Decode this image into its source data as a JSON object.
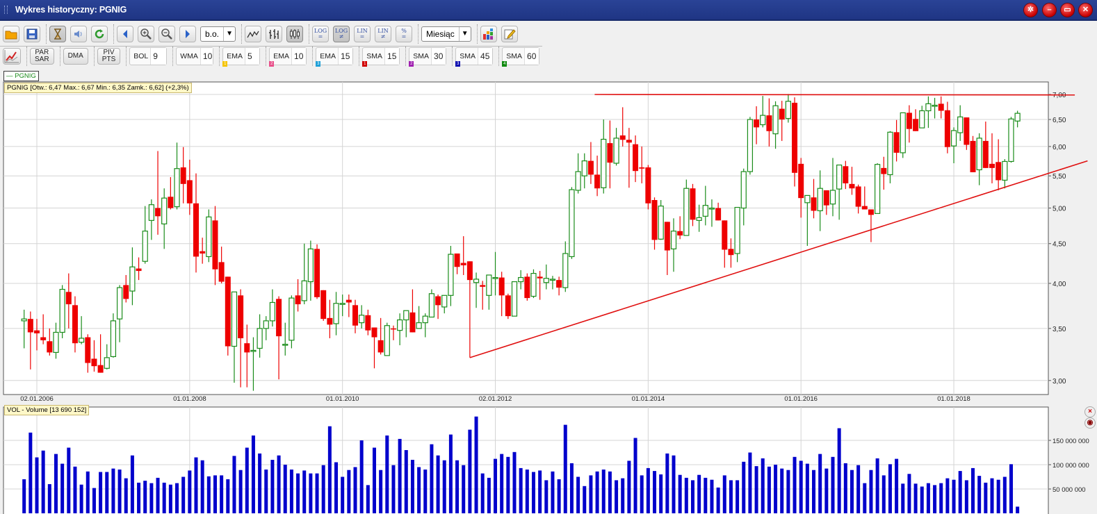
{
  "window": {
    "title": "Wykres historyczny: PGNIG",
    "controls": [
      "settings-icon",
      "minimize-icon",
      "print-icon",
      "close-icon"
    ]
  },
  "toolbar1": [
    [
      {
        "icon": "folder-icon"
      },
      {
        "icon": "save-icon"
      }
    ],
    [
      {
        "icon": "hourglass-icon",
        "pressed": true
      },
      {
        "icon": "speaker-icon"
      },
      {
        "icon": "refresh-icon"
      }
    ],
    [
      {
        "icon": "arrow-left-icon"
      },
      {
        "icon": "zoom-in-icon"
      },
      {
        "icon": "zoom-out-icon"
      },
      {
        "icon": "arrow-right-icon"
      },
      {
        "select": "b.o."
      }
    ],
    [
      {
        "icon": "line-chart-icon"
      },
      {
        "icon": "bar-chart-icon"
      },
      {
        "icon": "candlestick-chart-icon",
        "pressed": true
      }
    ],
    [
      {
        "label": "LOG\n=",
        "name": "log-equal"
      },
      {
        "label": "LOG\n≠",
        "name": "log-notequal",
        "pressed": true
      },
      {
        "label": "LIN\n=",
        "name": "lin-equal"
      },
      {
        "label": "LIN\n≠",
        "name": "lin-notequal"
      },
      {
        "label": "%\n=",
        "name": "percent-equal"
      }
    ],
    [
      {
        "select": "Miesiąc"
      }
    ],
    [
      {
        "icon": "palette-icon"
      },
      {
        "icon": "edit-icon"
      }
    ]
  ],
  "toolbar2": {
    "indicators_icon": "indicators-chart-icon",
    "buttons": [
      "PAR\nSAR",
      "DMA",
      "PIV\nPTS"
    ],
    "params": [
      {
        "name": "BOL",
        "value": "9"
      },
      {
        "name": "WMA",
        "value": "10"
      },
      {
        "name": "EMA",
        "value": "5",
        "badge": "1",
        "color": "#f5c400"
      },
      {
        "name": "EMA",
        "value": "10",
        "badge": "2",
        "color": "#e8508a"
      },
      {
        "name": "EMA",
        "value": "15",
        "badge": "3",
        "color": "#1ea0d8"
      },
      {
        "name": "SMA",
        "value": "15",
        "badge": "1",
        "color": "#d00000"
      },
      {
        "name": "SMA",
        "value": "30",
        "badge": "2",
        "color": "#a020b0"
      },
      {
        "name": "SMA",
        "value": "45",
        "badge": "3",
        "color": "#1010b0"
      },
      {
        "name": "SMA",
        "value": "60",
        "badge": "4",
        "color": "#108a10"
      }
    ]
  },
  "legend": {
    "label": "— PGNIG"
  },
  "info": {
    "text": "PGNIG [Otw.: 6,47  Max.: 6,67  Min.: 6,35  Zamk.: 6,62] (+2,3%)"
  },
  "volume_info": {
    "text": "VOL - Volume [13 690 152]"
  },
  "colors": {
    "up": "#1a8c1a",
    "down": "#ee0000",
    "volume": "#0000cc",
    "trendline": "#e01010",
    "grid": "#d4d4d4"
  },
  "chart_data": [
    {
      "type": "candlestick",
      "title": "PGNIG",
      "scale": "log",
      "interval": "month",
      "first_period": "2005-11",
      "ylim": [
        2.9,
        7.05
      ],
      "yticks": [
        7.0,
        6.5,
        6.0,
        5.5,
        5.0,
        4.5,
        4.0,
        3.5,
        3.0
      ],
      "ytick_labels": [
        "7,00",
        "6,50",
        "6,00",
        "5,50",
        "5,00",
        "4,50",
        "4,00",
        "3,50",
        "3,00"
      ],
      "xticks": [
        {
          "index": 3,
          "label": "02.01.2006"
        },
        {
          "index": 27,
          "label": "01.01.2008"
        },
        {
          "index": 51,
          "label": "01.01.2010"
        },
        {
          "index": 75,
          "label": "02.01.2012"
        },
        {
          "index": 99,
          "label": "01.01.2014"
        },
        {
          "index": 123,
          "label": "01.01.2016"
        },
        {
          "index": 147,
          "label": "01.01.2018"
        }
      ],
      "ohlc": [
        [
          3.58,
          3.7,
          3.3,
          3.6
        ],
        [
          3.6,
          3.68,
          3.1,
          3.46
        ],
        [
          3.48,
          3.6,
          3.28,
          3.45
        ],
        [
          3.41,
          3.65,
          3.34,
          3.38
        ],
        [
          3.37,
          3.5,
          3.23,
          3.26
        ],
        [
          3.26,
          3.56,
          3.2,
          3.46
        ],
        [
          3.46,
          3.98,
          3.4,
          3.93
        ],
        [
          3.9,
          4.12,
          3.5,
          3.76
        ],
        [
          3.75,
          3.85,
          3.26,
          3.35
        ],
        [
          3.36,
          3.63,
          3.34,
          3.4
        ],
        [
          3.41,
          3.44,
          3.07,
          3.16
        ],
        [
          3.2,
          3.38,
          3.08,
          3.13
        ],
        [
          3.14,
          3.44,
          3.07,
          3.07
        ],
        [
          3.11,
          3.34,
          3.1,
          3.21
        ],
        [
          3.22,
          3.66,
          3.21,
          3.58
        ],
        [
          3.6,
          3.98,
          3.36,
          3.95
        ],
        [
          3.98,
          4.1,
          3.78,
          3.82
        ],
        [
          3.91,
          4.45,
          3.75,
          4.2
        ],
        [
          4.18,
          4.32,
          4.04,
          4.15
        ],
        [
          4.27,
          5.03,
          4.24,
          4.67
        ],
        [
          4.82,
          5.13,
          4.55,
          5.05
        ],
        [
          5.0,
          5.92,
          4.62,
          4.88
        ],
        [
          4.77,
          5.3,
          4.43,
          5.15
        ],
        [
          5.17,
          5.48,
          4.98,
          5.0
        ],
        [
          5.02,
          6.07,
          4.98,
          5.62
        ],
        [
          5.64,
          5.99,
          5.07,
          5.37
        ],
        [
          5.43,
          5.77,
          4.9,
          5.07
        ],
        [
          5.07,
          5.54,
          4.13,
          4.33
        ],
        [
          4.4,
          4.58,
          4.24,
          4.37
        ],
        [
          4.33,
          4.98,
          4.26,
          4.87
        ],
        [
          4.82,
          5.03,
          3.98,
          4.17
        ],
        [
          4.26,
          4.46,
          4.0,
          4.02
        ],
        [
          4.08,
          4.08,
          3.23,
          3.32
        ],
        [
          3.32,
          3.9,
          2.98,
          3.9
        ],
        [
          3.86,
          3.93,
          2.94,
          3.4
        ],
        [
          3.35,
          3.54,
          2.94,
          3.26
        ],
        [
          3.27,
          3.41,
          2.91,
          3.28
        ],
        [
          3.3,
          3.65,
          3.21,
          3.5
        ],
        [
          3.5,
          3.63,
          3.38,
          3.58
        ],
        [
          3.58,
          3.93,
          3.52,
          3.78
        ],
        [
          3.82,
          3.85,
          3.01,
          3.42
        ],
        [
          3.33,
          3.56,
          3.23,
          3.34
        ],
        [
          3.38,
          3.86,
          3.3,
          3.83
        ],
        [
          3.86,
          4.05,
          3.68,
          3.76
        ],
        [
          3.8,
          4.5,
          3.76,
          4.03
        ],
        [
          4.02,
          4.54,
          3.8,
          4.43
        ],
        [
          4.43,
          4.49,
          3.82,
          3.84
        ],
        [
          3.92,
          3.92,
          3.58,
          3.6
        ],
        [
          3.61,
          3.81,
          3.4,
          3.54
        ],
        [
          3.55,
          3.9,
          3.43,
          3.77
        ],
        [
          3.76,
          3.87,
          3.63,
          3.77
        ],
        [
          3.81,
          3.87,
          3.62,
          3.78
        ],
        [
          3.75,
          3.81,
          3.45,
          3.53
        ],
        [
          3.56,
          3.75,
          3.5,
          3.64
        ],
        [
          3.64,
          3.7,
          3.43,
          3.48
        ],
        [
          3.51,
          3.51,
          3.11,
          3.41
        ],
        [
          3.38,
          3.61,
          3.24,
          3.26
        ],
        [
          3.23,
          3.56,
          3.23,
          3.53
        ],
        [
          3.5,
          3.53,
          3.38,
          3.49
        ],
        [
          3.48,
          3.66,
          3.33,
          3.59
        ],
        [
          3.59,
          3.69,
          3.41,
          3.69
        ],
        [
          3.67,
          3.93,
          3.46,
          3.46
        ],
        [
          3.5,
          3.74,
          3.5,
          3.56
        ],
        [
          3.56,
          3.66,
          3.41,
          3.63
        ],
        [
          3.62,
          3.93,
          3.62,
          3.88
        ],
        [
          3.85,
          3.87,
          3.6,
          3.75
        ],
        [
          3.73,
          3.86,
          3.66,
          3.86
        ],
        [
          3.86,
          4.47,
          3.74,
          4.36
        ],
        [
          4.37,
          4.37,
          4.11,
          4.2
        ],
        [
          4.25,
          4.6,
          4.1,
          4.22
        ],
        [
          4.27,
          4.27,
          3.21,
          4.04
        ],
        [
          4.01,
          4.13,
          3.72,
          4.05
        ],
        [
          3.98,
          4.03,
          3.7,
          3.96
        ],
        [
          3.86,
          4.1,
          3.7,
          4.1
        ],
        [
          4.07,
          4.39,
          3.86,
          4.07
        ],
        [
          4.07,
          4.14,
          3.63,
          3.86
        ],
        [
          3.86,
          3.88,
          3.6,
          3.63
        ],
        [
          3.63,
          4.02,
          3.63,
          4.02
        ],
        [
          4.02,
          4.16,
          3.93,
          4.07
        ],
        [
          4.08,
          4.12,
          3.8,
          3.83
        ],
        [
          3.85,
          4.17,
          3.83,
          4.12
        ],
        [
          4.08,
          4.15,
          3.81,
          4.06
        ],
        [
          4.01,
          4.23,
          3.93,
          4.06
        ],
        [
          4.05,
          4.09,
          3.93,
          4.05
        ],
        [
          4.04,
          4.08,
          3.86,
          3.95
        ],
        [
          3.95,
          4.53,
          3.9,
          4.37
        ],
        [
          4.33,
          5.32,
          4.3,
          5.28
        ],
        [
          5.27,
          5.88,
          5.22,
          5.57
        ],
        [
          5.5,
          5.88,
          5.3,
          5.75
        ],
        [
          5.75,
          6.08,
          5.37,
          5.52
        ],
        [
          5.52,
          5.84,
          5.18,
          5.3
        ],
        [
          5.31,
          6.5,
          5.22,
          6.13
        ],
        [
          6.06,
          6.48,
          5.3,
          5.72
        ],
        [
          5.71,
          6.34,
          5.67,
          6.15
        ],
        [
          6.2,
          6.74,
          6.0,
          6.12
        ],
        [
          6.12,
          6.34,
          5.31,
          6.07
        ],
        [
          6.04,
          6.2,
          5.4,
          5.58
        ],
        [
          5.64,
          6.0,
          5.38,
          5.62
        ],
        [
          5.64,
          5.68,
          4.98,
          5.07
        ],
        [
          5.12,
          5.16,
          4.42,
          4.55
        ],
        [
          4.56,
          5.12,
          4.55,
          5.03
        ],
        [
          4.8,
          4.8,
          4.1,
          4.41
        ],
        [
          4.43,
          4.85,
          4.14,
          4.67
        ],
        [
          4.67,
          4.88,
          4.56,
          4.61
        ],
        [
          4.61,
          5.44,
          4.61,
          5.3
        ],
        [
          5.3,
          5.37,
          4.74,
          4.83
        ],
        [
          4.82,
          5.05,
          4.66,
          4.86
        ],
        [
          4.88,
          5.34,
          4.75,
          5.04
        ],
        [
          5.0,
          5.13,
          4.73,
          5.0
        ],
        [
          5.0,
          5.08,
          4.82,
          4.82
        ],
        [
          4.82,
          4.82,
          4.19,
          4.42
        ],
        [
          4.43,
          4.57,
          4.19,
          4.35
        ],
        [
          4.37,
          5.01,
          4.26,
          5.01
        ],
        [
          5.0,
          5.62,
          4.75,
          5.57
        ],
        [
          5.57,
          6.55,
          5.52,
          6.5
        ],
        [
          6.5,
          6.76,
          6.04,
          6.35
        ],
        [
          6.4,
          6.97,
          6.35,
          6.58
        ],
        [
          6.58,
          6.92,
          6.0,
          6.28
        ],
        [
          6.23,
          6.86,
          5.96,
          6.77
        ],
        [
          6.71,
          6.87,
          6.1,
          6.5
        ],
        [
          6.52,
          7.01,
          6.44,
          6.86
        ],
        [
          6.83,
          6.94,
          5.33,
          5.55
        ],
        [
          5.7,
          5.8,
          4.86,
          5.15
        ],
        [
          5.08,
          5.19,
          4.47,
          5.19
        ],
        [
          5.16,
          5.45,
          4.85,
          4.96
        ],
        [
          4.96,
          5.59,
          4.67,
          5.3
        ],
        [
          5.27,
          5.27,
          4.9,
          5.04
        ],
        [
          5.06,
          5.8,
          4.88,
          5.27
        ],
        [
          5.29,
          5.68,
          4.83,
          5.68
        ],
        [
          5.66,
          5.75,
          5.29,
          5.38
        ],
        [
          5.37,
          5.65,
          5.2,
          5.3
        ],
        [
          5.33,
          5.36,
          4.92,
          5.02
        ],
        [
          5.03,
          5.33,
          4.98,
          4.98
        ],
        [
          4.98,
          4.98,
          4.52,
          4.9
        ],
        [
          4.92,
          5.71,
          4.92,
          5.69
        ],
        [
          5.63,
          5.82,
          5.28,
          5.53
        ],
        [
          5.52,
          6.28,
          5.38,
          6.26
        ],
        [
          6.26,
          6.49,
          5.74,
          5.89
        ],
        [
          5.89,
          6.63,
          5.8,
          6.63
        ],
        [
          6.63,
          6.78,
          6.07,
          6.32
        ],
        [
          6.51,
          6.7,
          6.28,
          6.28
        ],
        [
          6.34,
          6.77,
          6.34,
          6.67
        ],
        [
          6.67,
          6.96,
          6.34,
          6.81
        ],
        [
          6.78,
          6.93,
          6.52,
          6.78
        ],
        [
          6.81,
          6.96,
          6.52,
          6.67
        ],
        [
          6.68,
          6.85,
          5.88,
          5.99
        ],
        [
          6.01,
          6.35,
          5.71,
          6.29
        ],
        [
          6.25,
          6.78,
          6.1,
          6.55
        ],
        [
          6.54,
          6.54,
          5.94,
          6.03
        ],
        [
          6.1,
          6.19,
          5.56,
          5.56
        ],
        [
          5.6,
          6.24,
          5.35,
          6.15
        ],
        [
          6.1,
          6.46,
          5.63,
          5.63
        ],
        [
          5.7,
          6.24,
          5.38,
          5.63
        ],
        [
          5.73,
          6.13,
          5.27,
          5.43
        ],
        [
          5.43,
          5.78,
          5.3,
          5.74
        ],
        [
          5.74,
          6.55,
          5.72,
          6.51
        ],
        [
          6.47,
          6.67,
          6.35,
          6.62
        ]
      ],
      "trendlines": [
        {
          "from": [
            90.6,
            7.0
          ],
          "to": [
            166,
            6.99
          ]
        },
        {
          "from": [
            71,
            3.21
          ],
          "to": [
            168,
            5.75
          ]
        }
      ]
    },
    {
      "type": "bar",
      "title": "VOL - Volume",
      "unit": "millions",
      "ylim": [
        0,
        215
      ],
      "yticks": [
        150,
        100,
        50
      ],
      "ytick_labels": [
        "150 000 000",
        "100 000 000",
        "50 000 000"
      ],
      "values": [
        70,
        166,
        115,
        129,
        60,
        122,
        102,
        135,
        96,
        59,
        86,
        52,
        85,
        85,
        92,
        90,
        72,
        119,
        63,
        67,
        62,
        73,
        63,
        59,
        62,
        75,
        88,
        115,
        109,
        76,
        78,
        78,
        70,
        118,
        89,
        135,
        160,
        123,
        90,
        110,
        119,
        100,
        90,
        82,
        88,
        82,
        82,
        99,
        179,
        105,
        75,
        89,
        95,
        150,
        58,
        135,
        89,
        160,
        99,
        153,
        130,
        110,
        95,
        90,
        142,
        119,
        109,
        162,
        109,
        99,
        172,
        199,
        82,
        73,
        112,
        122,
        116,
        126,
        93,
        90,
        85,
        88,
        68,
        86,
        70,
        182,
        103,
        75,
        56,
        78,
        86,
        90,
        86,
        68,
        72,
        108,
        155,
        78,
        93,
        87,
        80,
        123,
        119,
        79,
        73,
        68,
        79,
        73,
        69,
        53,
        78,
        68,
        68,
        106,
        125,
        97,
        113,
        96,
        100,
        92,
        89,
        116,
        108,
        102,
        89,
        122,
        92,
        116,
        175,
        103,
        89,
        99,
        62,
        89,
        113,
        78,
        101,
        112,
        61,
        81,
        61,
        55,
        62,
        58,
        62,
        72,
        69,
        87,
        68,
        93,
        77,
        63,
        72,
        69,
        75,
        101,
        13.69
      ]
    }
  ]
}
